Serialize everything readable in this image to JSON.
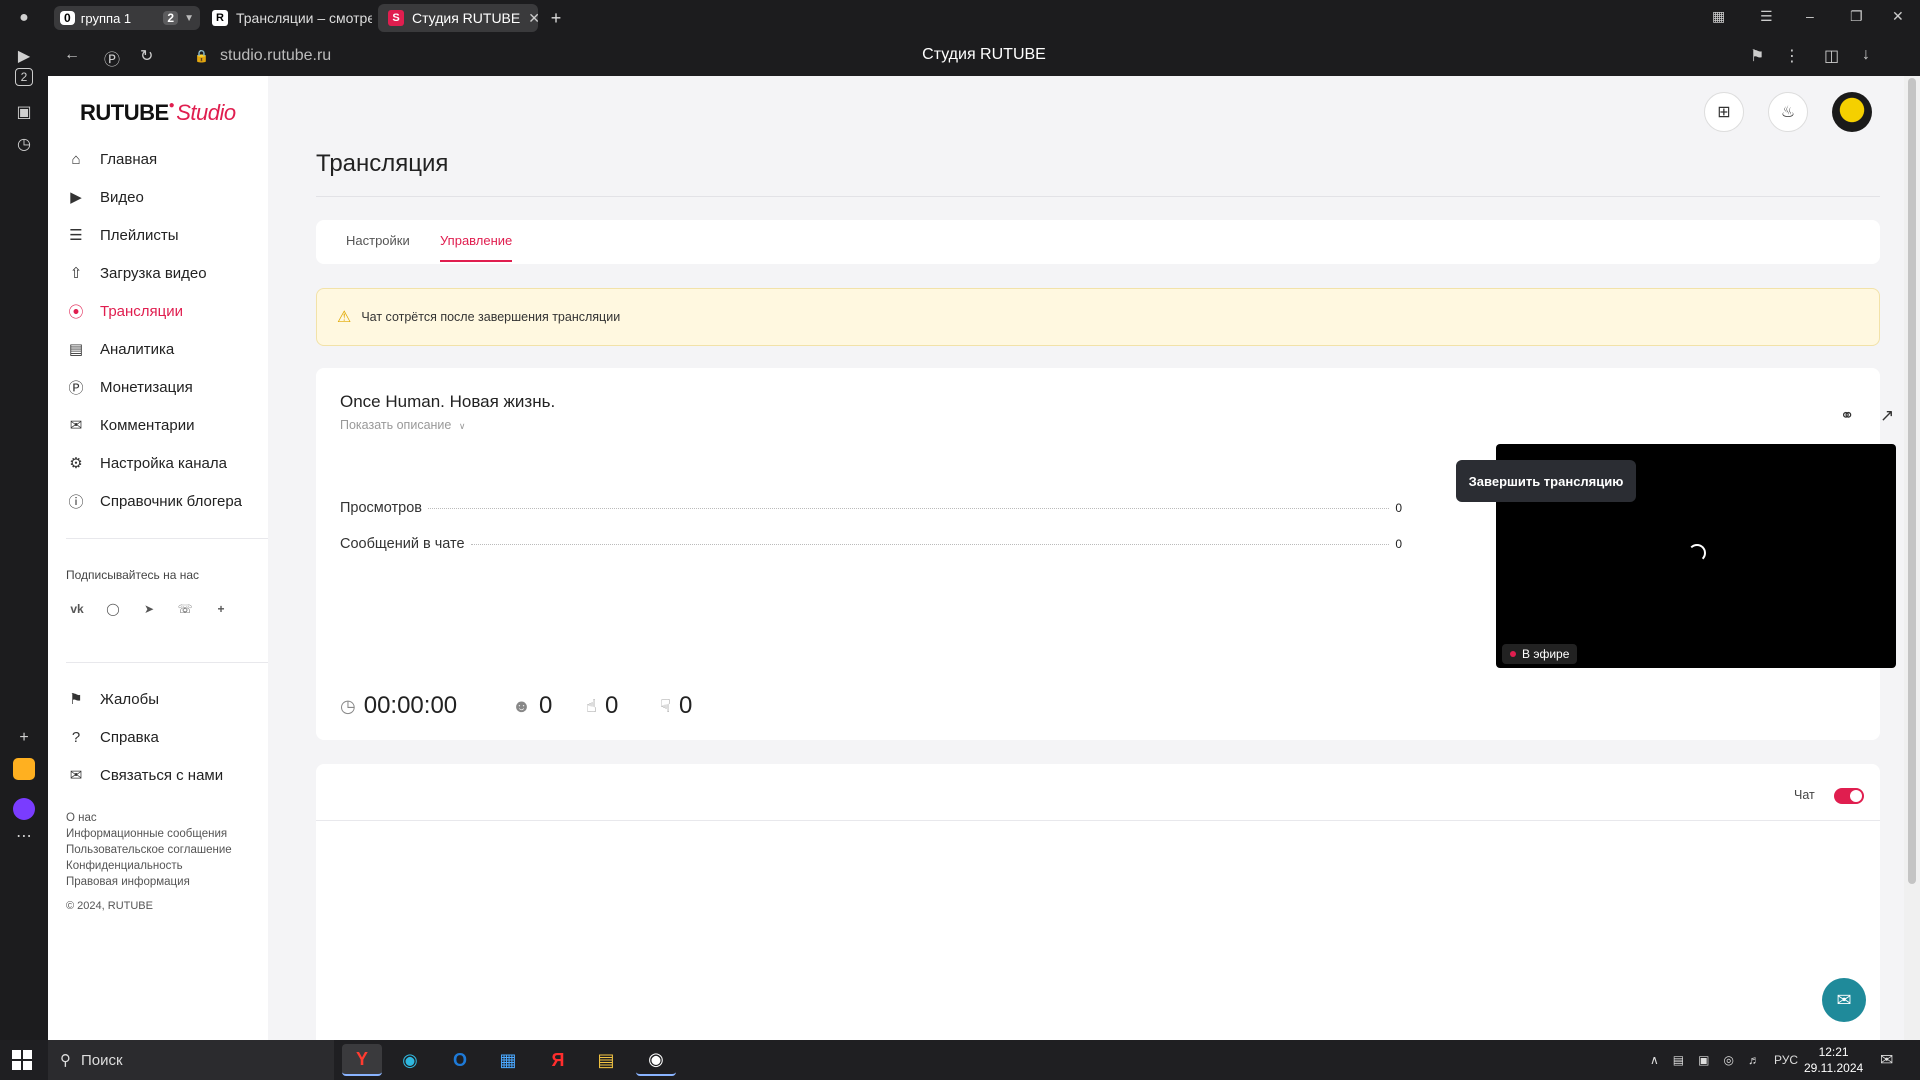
{
  "browser": {
    "group": {
      "count": "0",
      "label": "группа 1",
      "tabs_count": "2"
    },
    "tabs": [
      {
        "label": "Трансляции – смотреть о",
        "favicon": "R"
      },
      {
        "label": "Студия RUTUBE",
        "favicon": "S"
      }
    ],
    "url": "studio.rutube.ru",
    "page_title": "Студия RUTUBE",
    "left_rail": {
      "badge": "2"
    }
  },
  "logo": {
    "main": "RUTUBE",
    "studio": "Studio"
  },
  "sidebar": {
    "items": [
      {
        "label": "Главная",
        "icon": "home-icon"
      },
      {
        "label": "Видео",
        "icon": "video-icon"
      },
      {
        "label": "Плейлисты",
        "icon": "list-icon"
      },
      {
        "label": "Загрузка видео",
        "icon": "upload-icon"
      },
      {
        "label": "Трансляции",
        "icon": "broadcast-icon"
      },
      {
        "label": "Аналитика",
        "icon": "chart-icon"
      },
      {
        "label": "Монетизация",
        "icon": "coin-icon"
      },
      {
        "label": "Комментарии",
        "icon": "comment-icon"
      },
      {
        "label": "Настройка канала",
        "icon": "gear-icon"
      },
      {
        "label": "Справочник блогера",
        "icon": "info-icon"
      }
    ],
    "follow_label": "Подписывайтесь на нас",
    "socials": [
      "vk",
      "ok",
      "telegram",
      "viber",
      "more"
    ],
    "bottom_items": [
      {
        "label": "Жалобы",
        "icon": "flag-icon"
      },
      {
        "label": "Справка",
        "icon": "help-icon"
      },
      {
        "label": "Связаться с нами",
        "icon": "mail-icon"
      }
    ],
    "footer_links": [
      "О нас",
      "Информационные сообщения",
      "Пользовательское соглашение",
      "Конфиденциальность",
      "Правовая информация"
    ],
    "copyright": "© 2024, RUTUBE"
  },
  "header": {
    "title": "Трансляция"
  },
  "tabs": [
    {
      "label": "Настройки",
      "active": false
    },
    {
      "label": "Управление",
      "active": true
    }
  ],
  "warning": {
    "text": "Чат сотрётся после завершения трансляции"
  },
  "stream": {
    "title": "Once Human. Новая жизнь.",
    "show_description": "Показать описание",
    "stats": [
      {
        "label": "Просмотров",
        "value": "0"
      },
      {
        "label": "Сообщений в чате",
        "value": "0"
      }
    ],
    "timer": "00:00:00",
    "viewers": "0",
    "likes": "0",
    "dislikes": "0",
    "live_badge": "В эфире",
    "end_button": "Завершить трансляцию"
  },
  "chat": {
    "label": "Чат",
    "enabled": true
  },
  "taskbar": {
    "search_label": "Поиск",
    "language": "РУС",
    "time": "12:21",
    "date": "29.11.2024"
  },
  "colors": {
    "accent": "#e01e4f",
    "dark_button": "#2b2d33",
    "warning_bg": "#fff8e0"
  }
}
